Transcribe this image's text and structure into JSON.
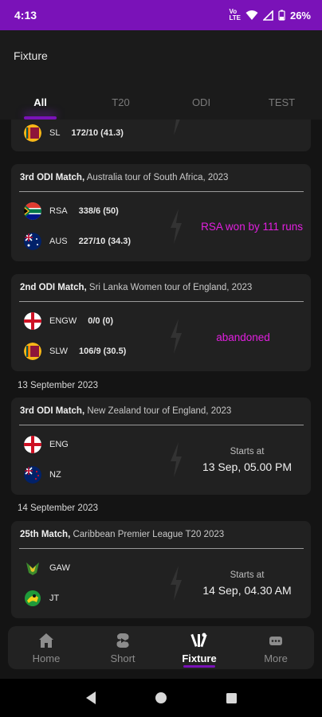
{
  "status_bar": {
    "time": "4:13",
    "network": "VoLTE",
    "battery": "26%"
  },
  "appbar": {
    "title": "Fixture"
  },
  "tabs": [
    {
      "label": "All",
      "active": true
    },
    {
      "label": "T20",
      "active": false
    },
    {
      "label": "ODI",
      "active": false
    },
    {
      "label": "TEST",
      "active": false
    }
  ],
  "partial_card": {
    "team": "SL",
    "score": "172/10 (41.3)"
  },
  "matches": [
    {
      "title_bold": "3rd ODI Match,",
      "title_rest": " Australia tour of South Africa, 2023",
      "team1": {
        "name": "RSA",
        "score": "338/6 (50)",
        "flag": "south-africa"
      },
      "team2": {
        "name": "AUS",
        "score": "227/10 (34.3)",
        "flag": "australia"
      },
      "result": "RSA won by 111 runs"
    },
    {
      "title_bold": "2nd ODI Match,",
      "title_rest": " Sri Lanka Women tour of England, 2023",
      "team1": {
        "name": "ENGW",
        "score": "0/0 (0)",
        "flag": "england"
      },
      "team2": {
        "name": "SLW",
        "score": "106/9 (30.5)",
        "flag": "sri-lanka"
      },
      "result": "abandoned"
    }
  ],
  "date_headers": [
    "13 September 2023",
    "14 September 2023"
  ],
  "upcoming": [
    {
      "title_bold": "3rd ODI Match,",
      "title_rest": " New Zealand tour of England, 2023",
      "team1": {
        "name": "ENG",
        "flag": "england"
      },
      "team2": {
        "name": "NZ",
        "flag": "new-zealand"
      },
      "starts_label": "Starts at",
      "starts_time": "13 Sep, 05.00 PM"
    },
    {
      "title_bold": "25th Match,",
      "title_rest": " Caribbean Premier League T20 2023",
      "team1": {
        "name": "GAW",
        "flag": "guyana-amazon-warriors"
      },
      "team2": {
        "name": "JT",
        "flag": "jamaica-tallawahs"
      },
      "starts_label": "Starts at",
      "starts_time": "14 Sep, 04.30 AM"
    }
  ],
  "bottom_nav": [
    {
      "label": "Home",
      "icon": "home-icon",
      "active": false
    },
    {
      "label": "Short",
      "icon": "shorts-icon",
      "active": false
    },
    {
      "label": "Fixture",
      "icon": "fixture-icon",
      "active": true
    },
    {
      "label": "More",
      "icon": "more-icon",
      "active": false
    }
  ],
  "colors": {
    "accent": "#7a12b8",
    "result": "#e21fe0",
    "background": "#141414",
    "card": "#212121"
  }
}
